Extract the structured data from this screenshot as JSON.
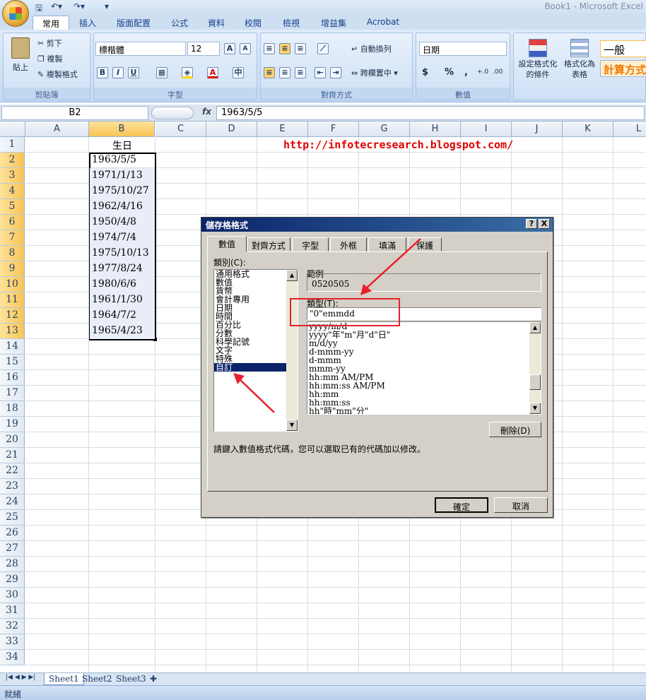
{
  "window": {
    "title": "Book1 - Microsoft Excel"
  },
  "tabs": [
    "常用",
    "插入",
    "版面配置",
    "公式",
    "資料",
    "校閱",
    "檢視",
    "增益集",
    "Acrobat"
  ],
  "ribbon": {
    "clipboard": {
      "paste": "貼上",
      "cut": "剪下",
      "copy": "複製",
      "format_painter": "複製格式",
      "label": "剪貼簿"
    },
    "font": {
      "name": "標楷體",
      "size": "12",
      "label": "字型",
      "bold": "B",
      "italic": "I",
      "underline": "U",
      "grow": "A",
      "shrink": "A",
      "phonetic": "中"
    },
    "alignment": {
      "wrap": "自動換列",
      "merge": "跨欄置中",
      "label": "對齊方式"
    },
    "number": {
      "format": "日期",
      "currency": "$",
      "percent": "%",
      "comma": ",",
      "inc_decimal": "+.0",
      "dec_decimal": ".00",
      "label": "數值"
    },
    "styles": {
      "conditional": "設定格式化的條件",
      "table": "格式化為表格",
      "normal": "一般",
      "calc": "計算方式"
    }
  },
  "formula_bar": {
    "name_box": "B2",
    "fx": "fx",
    "formula": "1963/5/5"
  },
  "columns": [
    "A",
    "B",
    "C",
    "D",
    "E",
    "F",
    "G",
    "H",
    "I",
    "J",
    "K",
    "L"
  ],
  "rows": [
    "1",
    "2",
    "3",
    "4",
    "5",
    "6",
    "7",
    "8",
    "9",
    "10",
    "11",
    "12",
    "13",
    "14",
    "15",
    "16",
    "17",
    "18",
    "19",
    "20",
    "21",
    "22",
    "23",
    "24",
    "25",
    "26",
    "27",
    "28",
    "29",
    "30",
    "31",
    "32",
    "33",
    "34"
  ],
  "cells": {
    "header": "生日",
    "dates": [
      "1963/5/5",
      "1971/1/13",
      "1975/10/27",
      "1962/4/16",
      "1950/4/8",
      "1974/7/4",
      "1975/10/13",
      "1977/8/24",
      "1980/6/6",
      "1961/1/30",
      "1964/7/2",
      "1965/4/23"
    ],
    "url": "http://infotecresearch.blogspot.com/"
  },
  "sheets": [
    "Sheet1",
    "Sheet2",
    "Sheet3"
  ],
  "status": "就緒",
  "dialog": {
    "title": "儲存格格式",
    "help": "?",
    "close": "X",
    "tabs": [
      "數值",
      "對齊方式",
      "字型",
      "外框",
      "填滿",
      "保護"
    ],
    "category_label": "類別(C):",
    "categories": [
      "通用格式",
      "數值",
      "貨幣",
      "會計專用",
      "日期",
      "時間",
      "百分比",
      "分數",
      "科學記號",
      "文字",
      "特殊",
      "自訂"
    ],
    "sample_label": "範例",
    "sample_value": "0520505",
    "type_label": "類型(T):",
    "type_value": "\"0\"emmdd",
    "type_list": [
      "yyyy/m/d",
      "yyyy\"年\"m\"月\"d\"日\"",
      "m/d/yy",
      "d-mmm-yy",
      "d-mmm",
      "mmm-yy",
      "hh:mm AM/PM",
      "hh:mm:ss AM/PM",
      "hh:mm",
      "hh:mm:ss",
      "hh\"時\"mm\"分\""
    ],
    "delete": "刪除(D)",
    "hint": "請鍵入數值格式代碼，您可以選取已有的代碼加以修改。",
    "ok": "確定",
    "cancel": "取消"
  },
  "colors": {
    "annotation": "#e8202a",
    "url": "#e00000",
    "selection": "#0a246a"
  }
}
